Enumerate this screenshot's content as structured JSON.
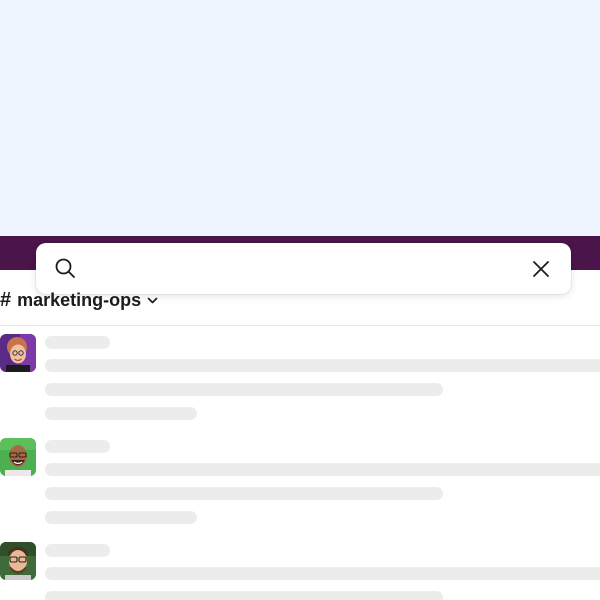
{
  "colors": {
    "top_background": "#eef5ff",
    "header_bar": "#4a154b",
    "skeleton": "#ececec"
  },
  "search": {
    "value": "",
    "placeholder": "",
    "search_icon": "search-icon",
    "close_icon": "close-icon"
  },
  "channel": {
    "hash": "#",
    "name": "marketing-ops",
    "dropdown_icon": "chevron-down-icon"
  },
  "messages": [
    {
      "avatar": "avatar-woman-purple-bg",
      "state": "loading"
    },
    {
      "avatar": "avatar-man-green-bg",
      "state": "loading"
    },
    {
      "avatar": "avatar-man-glasses",
      "state": "loading"
    }
  ]
}
